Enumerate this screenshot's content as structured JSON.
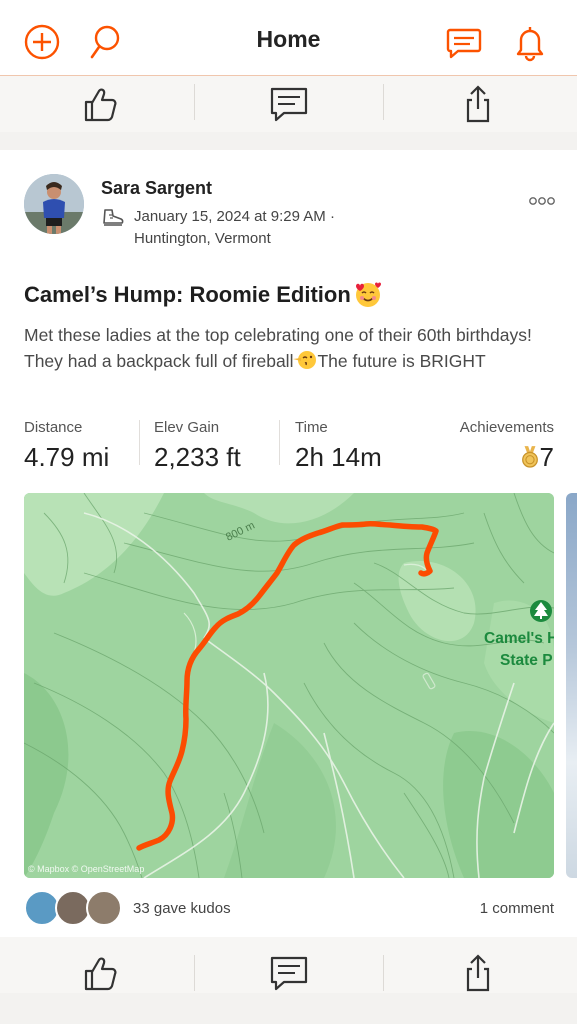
{
  "topbar": {
    "title": "Home",
    "icons": [
      "add-circle-icon",
      "search-icon",
      "messages-icon",
      "bell-icon"
    ],
    "accent": "#fc5200"
  },
  "post": {
    "author": "Sara Sargent",
    "date_time": "January 15, 2024 at 9:29 AM ·",
    "location": "Huntington, Vermont",
    "activity_icon": "hiking-boot-icon",
    "title": "Camel’s Hump: Roomie Edition",
    "title_emoji": "smiling-face-with-hearts",
    "description_part1": "Met these ladies at the top celebrating one of their 60th birthdays! They had a backpack full of fireball",
    "description_emoji": "kissing-face",
    "description_part2": "The future is BRIGHT",
    "stats": [
      {
        "label": "Distance",
        "value": "4.79 mi"
      },
      {
        "label": "Elev Gain",
        "value": "2,233 ft"
      },
      {
        "label": "Time",
        "value": "2h 14m"
      }
    ],
    "achievements": {
      "label": "Achievements",
      "value": "7",
      "icon": "medal-icon"
    },
    "map": {
      "contour_label": "800 m",
      "park_label_line1": "Camel's H",
      "park_label_line2": "State P",
      "attribution": "© Mapbox © OpenStreetMap",
      "route_color": "#fc4c02",
      "park_icon": "tree-icon"
    },
    "kudos_text": "33 gave kudos",
    "comments_text": "1 comment"
  },
  "actions": [
    "kudos-icon",
    "comment-icon",
    "share-icon"
  ]
}
